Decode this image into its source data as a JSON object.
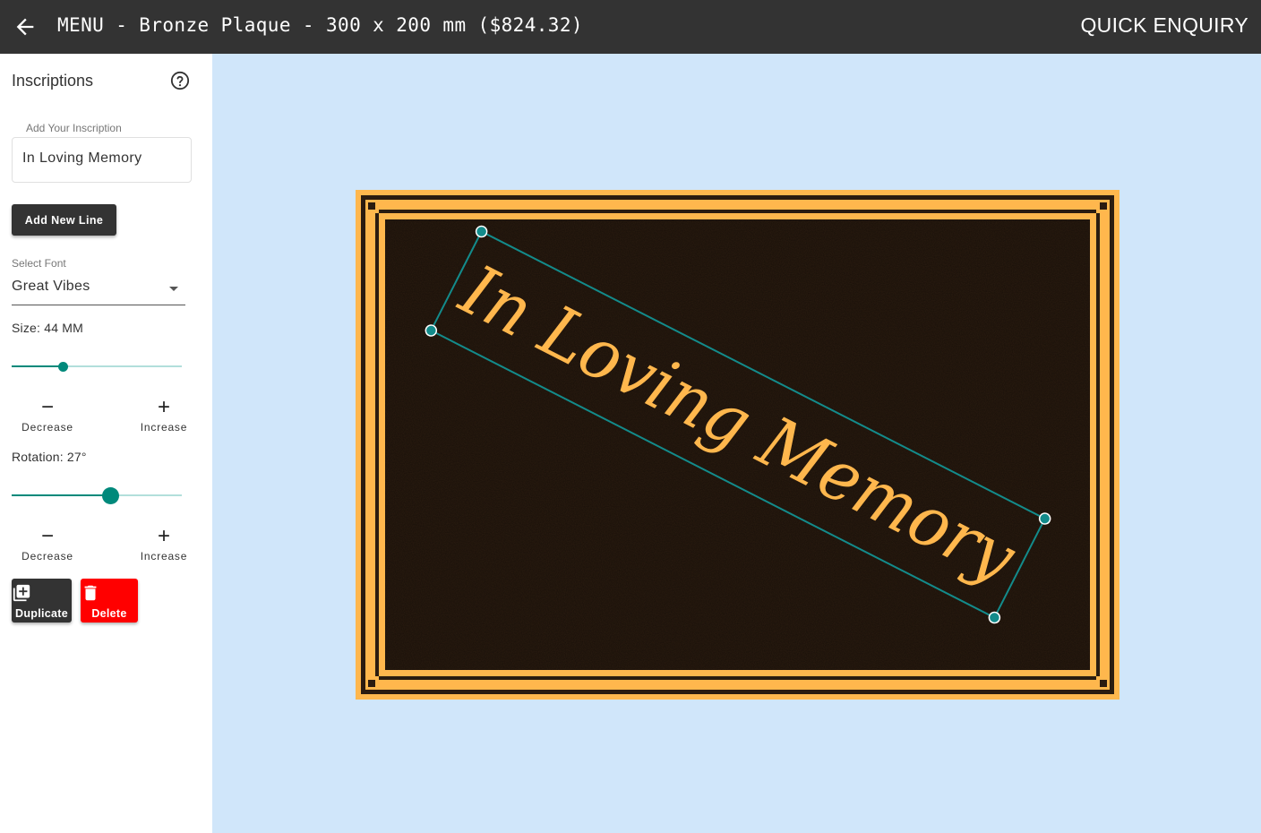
{
  "header": {
    "title": "MENU - Bronze Plaque - 300 x 200 mm ($824.32)",
    "quick_enquiry": "QUICK ENQUIRY"
  },
  "sidebar": {
    "panel_title": "Inscriptions",
    "inscription_label": "Add Your Inscription",
    "inscription_value": "In Loving Memory",
    "add_line": "Add New Line",
    "font_label": "Select Font",
    "font_value": "Great Vibes",
    "size": {
      "label": "Size: 44 MM",
      "value_fraction": 0.3,
      "decrease": "Decrease",
      "increase": "Increase"
    },
    "rotation": {
      "label": "Rotation: 27°",
      "value_fraction": 0.58,
      "decrease": "Decrease",
      "increase": "Increase"
    },
    "duplicate": "Duplicate",
    "delete": "Delete"
  },
  "plaque": {
    "inscription_text": "In Loving Memory",
    "rotation_deg": 27
  },
  "colors": {
    "topbar": "#333333",
    "canvas_bg": "#d0e6fa",
    "bronze_dark": "#2b1c10",
    "bronze_gold": "#ffb74d",
    "accent_teal": "#00897b",
    "selection": "#138b8b",
    "delete_red": "#ff0000"
  },
  "icons": {
    "back": "arrow-left-icon",
    "help": "help-circle-icon",
    "dropdown": "chevron-down-icon",
    "duplicate": "library-add-icon",
    "delete": "trash-icon"
  }
}
